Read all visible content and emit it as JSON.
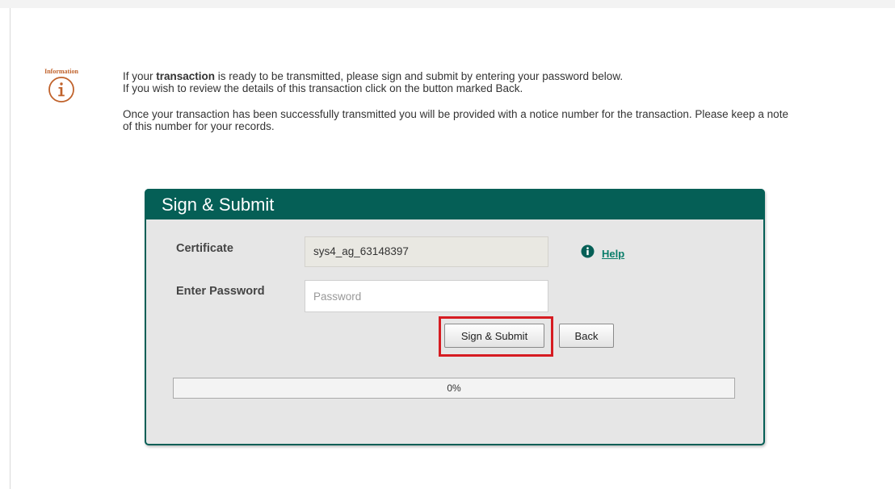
{
  "info": {
    "label": "Information",
    "icon": "info-circle-icon",
    "paragraph1": {
      "prefix": "If your ",
      "bold": "transaction",
      "rest_line1": " is ready to be transmitted, please sign and submit by entering your password below.",
      "line2": "If you wish to review the details of this transaction click on the button marked Back."
    },
    "paragraph2": "Once your transaction has been successfully transmitted you will be provided with a notice number for the transaction. Please keep a note of this number for your records."
  },
  "panel": {
    "title": "Sign & Submit",
    "certificate_label": "Certificate",
    "certificate_value": "sys4_ag_63148397",
    "password_label": "Enter Password",
    "password_placeholder": "Password",
    "password_value": "",
    "help_icon": "info-circle-filled-icon",
    "help_link": "Help",
    "submit_button": "Sign & Submit",
    "back_button": "Back",
    "progress_value": 0,
    "progress_text": "0%"
  },
  "colors": {
    "accent": "#055f56",
    "link": "#0a7d6a",
    "highlight": "#d61c22",
    "info_icon": "#c0622b"
  }
}
